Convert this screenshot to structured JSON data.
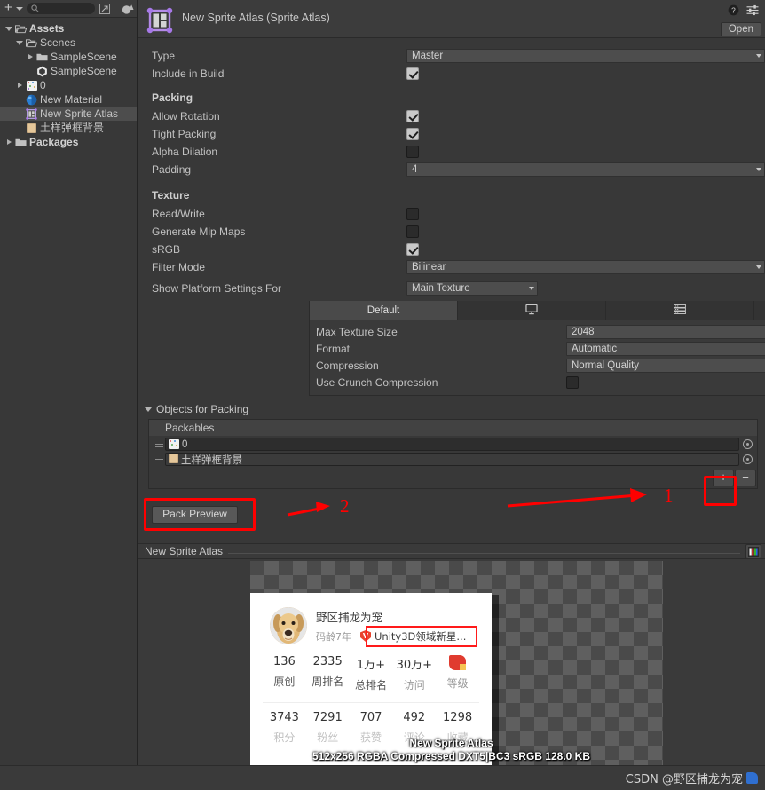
{
  "project_panel": {
    "toolbar": {
      "create_label": "+",
      "create_dropdown_icon": "chevron-down-icon",
      "search_placeholder": "",
      "search_icon": "search-icon",
      "open_in_new_icon": "open-external-icon",
      "favorites_icon": "favorites-icon"
    },
    "tree": [
      {
        "label": "Assets",
        "indent": 0,
        "arrow": "open",
        "icon": "folder-open-icon",
        "bold": true,
        "selected": false
      },
      {
        "label": "Scenes",
        "indent": 1,
        "arrow": "open",
        "icon": "folder-open-icon",
        "bold": false,
        "selected": false
      },
      {
        "label": "SampleScene",
        "indent": 2,
        "arrow": "closed",
        "icon": "folder-icon",
        "bold": false,
        "selected": false
      },
      {
        "label": "SampleScene",
        "indent": 2,
        "arrow": "none",
        "icon": "unity-scene-icon",
        "bold": false,
        "selected": false
      },
      {
        "label": "0",
        "indent": 1,
        "arrow": "closed",
        "icon": "sprite-sheet-icon",
        "bold": false,
        "selected": false
      },
      {
        "label": "New Material",
        "indent": 1,
        "arrow": "none",
        "icon": "material-icon",
        "bold": false,
        "selected": false
      },
      {
        "label": "New Sprite Atlas",
        "indent": 1,
        "arrow": "none",
        "icon": "sprite-atlas-icon",
        "bold": false,
        "selected": true
      },
      {
        "label": "土样弹框背景",
        "indent": 1,
        "arrow": "none",
        "icon": "texture-icon",
        "bold": false,
        "selected": false
      },
      {
        "label": "Packages",
        "indent": 0,
        "arrow": "closed",
        "icon": "folder-icon",
        "bold": true,
        "selected": false
      }
    ]
  },
  "inspector": {
    "asset_icon": "sprite-atlas-icon",
    "title": "New Sprite Atlas (Sprite Atlas)",
    "help_icon": "help-icon",
    "settings_icon": "preset-settings-icon",
    "open_button": "Open",
    "type": {
      "label": "Type",
      "value": "Master"
    },
    "include_in_build": {
      "label": "Include in Build",
      "checked": true
    },
    "packing_section": "Packing",
    "allow_rotation": {
      "label": "Allow Rotation",
      "checked": true
    },
    "tight_packing": {
      "label": "Tight Packing",
      "checked": true
    },
    "alpha_dilation": {
      "label": "Alpha Dilation",
      "checked": false
    },
    "padding": {
      "label": "Padding",
      "value": "4"
    },
    "texture_section": "Texture",
    "read_write": {
      "label": "Read/Write",
      "checked": false
    },
    "generate_mip_maps": {
      "label": "Generate Mip Maps",
      "checked": false
    },
    "srgb": {
      "label": "sRGB",
      "checked": true
    },
    "filter_mode": {
      "label": "Filter Mode",
      "value": "Bilinear"
    },
    "show_platform_settings_for": {
      "label": "Show Platform Settings For",
      "value": "Main Texture"
    },
    "platform_tabs": [
      {
        "label": "Default",
        "icon": "",
        "active": true
      },
      {
        "label": "",
        "icon": "standalone-monitor-icon",
        "active": false
      },
      {
        "label": "",
        "icon": "android-device-icon",
        "active": false
      },
      {
        "label": "",
        "icon": "webgl-html5-icon",
        "active": false
      }
    ],
    "platform_settings": {
      "max_texture_size": {
        "label": "Max Texture Size",
        "value": "2048"
      },
      "format": {
        "label": "Format",
        "value": "Automatic"
      },
      "compression": {
        "label": "Compression",
        "value": "Normal Quality"
      },
      "use_crunch": {
        "label": "Use Crunch Compression",
        "checked": false
      }
    },
    "objects_for_packing": {
      "header": "Objects for Packing",
      "column_header": "Packables",
      "rows": [
        {
          "name": "0",
          "icon": "sprite-sheet-icon"
        },
        {
          "name": "土样弹框背景",
          "icon": "texture-icon"
        }
      ],
      "add_button": "+",
      "remove_button": "−"
    },
    "pack_preview_button": "Pack Preview"
  },
  "annotations": {
    "marker_1": "1",
    "marker_2": "2",
    "highlight_color": "#ff0000"
  },
  "preview": {
    "title": "New Sprite Atlas",
    "rgba_toggle_icon": "rgba-channels-icon",
    "overlay_name": "New Sprite Atlas",
    "overlay_info": "512x256 RGBA Compressed DXT5|BC3 sRGB  128.0 KB",
    "card": {
      "avatar_icon": "dog-avatar",
      "username": "野区捕龙为宠",
      "coder_age": "码龄7年",
      "badge_icon": "csdn-verified-icon",
      "badge_text": "Unity3D领域新星...",
      "stats_row1": [
        {
          "value": "136",
          "label": "原创",
          "muted": false
        },
        {
          "value": "2335",
          "label": "周排名",
          "muted": false
        },
        {
          "value": "1万+",
          "label": "总排名",
          "muted": false
        },
        {
          "value": "30万+",
          "label": "访问",
          "muted": true
        },
        {
          "value": "",
          "label": "等级",
          "muted": true,
          "icon": "level-badge-icon"
        }
      ],
      "stats_row2": [
        {
          "value": "3743",
          "label": "积分"
        },
        {
          "value": "7291",
          "label": "粉丝"
        },
        {
          "value": "707",
          "label": "获赞"
        },
        {
          "value": "492",
          "label": "评论"
        },
        {
          "value": "1298",
          "label": "收藏"
        }
      ]
    }
  },
  "watermark": {
    "text": "CSDN @野区捕龙为宠",
    "icon": "tag-icon"
  }
}
